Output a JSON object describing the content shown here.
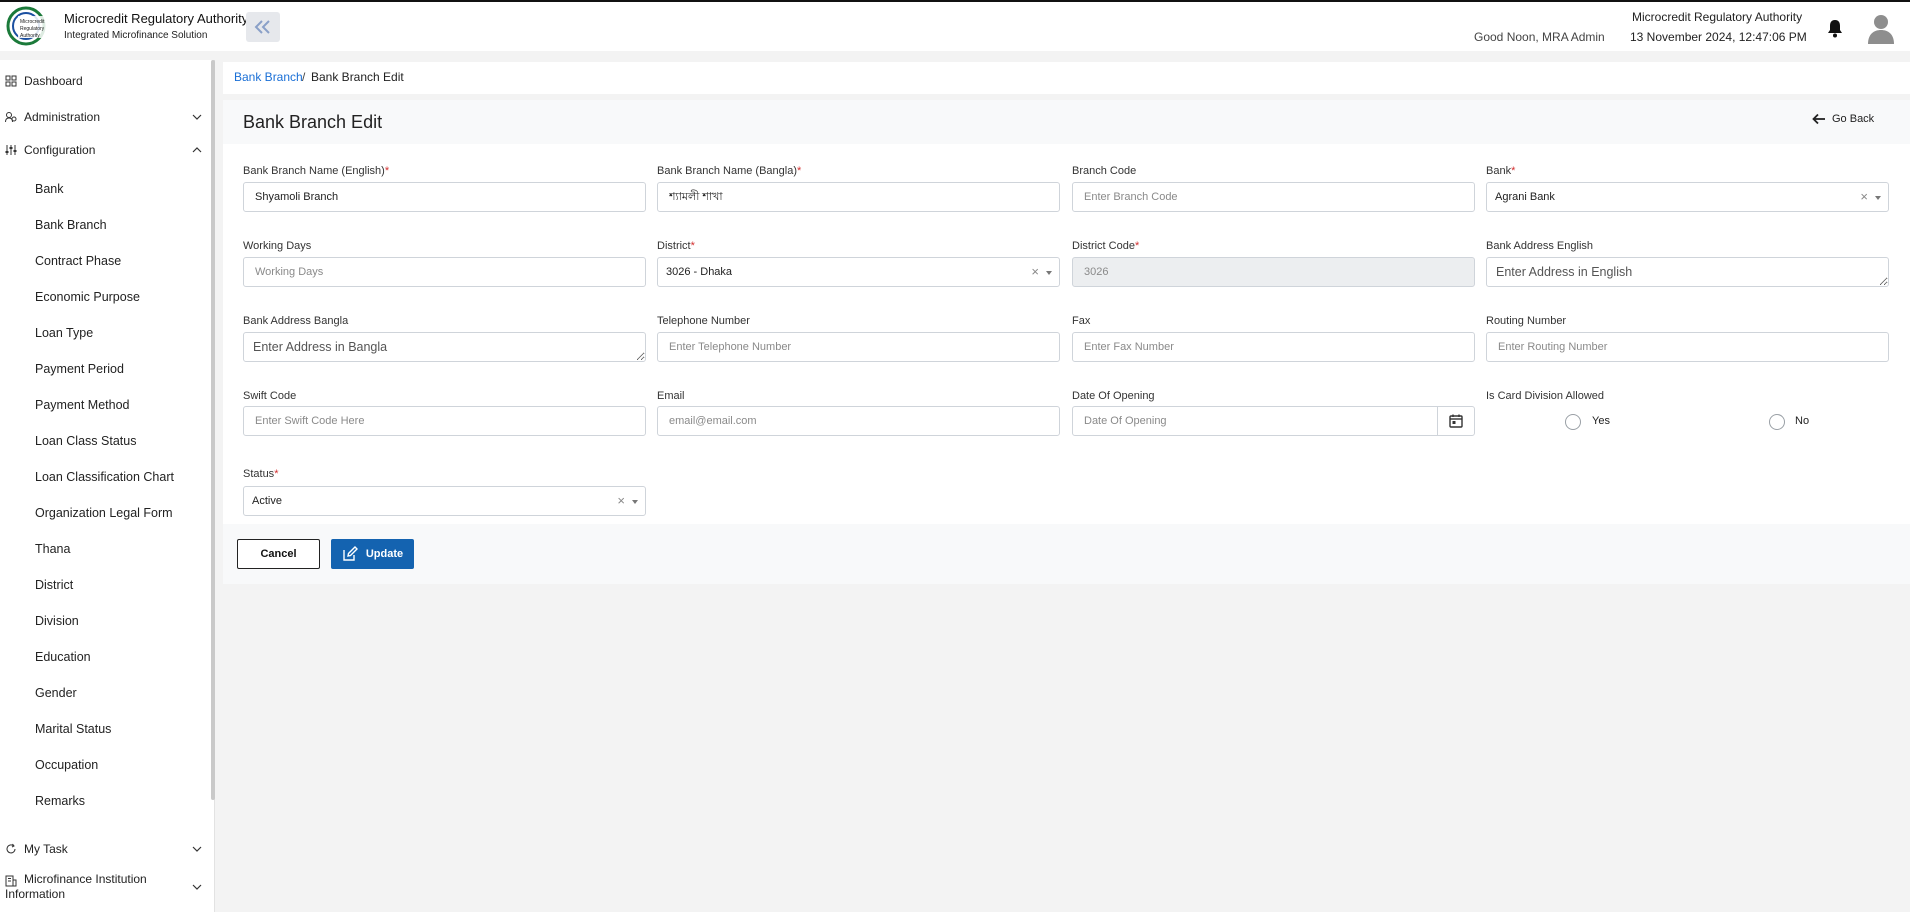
{
  "header": {
    "app_title": "Microcredit Regulatory Authority",
    "app_subtitle": "Integrated Microfinance Solution",
    "greeting": "Good Noon, MRA Admin",
    "org_name": "Microcredit Regulatory Authority",
    "datetime": "13 November 2024, 12:47:06 PM"
  },
  "sidebar": {
    "dashboard": "Dashboard",
    "administration": "Administration",
    "configuration": "Configuration",
    "config_items": [
      "Bank",
      "Bank Branch",
      "Contract Phase",
      "Economic Purpose",
      "Loan Type",
      "Payment Period",
      "Payment Method",
      "Loan Class Status",
      "Loan Classification Chart",
      "Organization Legal Form",
      "Thana",
      "District",
      "Division",
      "Education",
      "Gender",
      "Marital Status",
      "Occupation",
      "Remarks"
    ],
    "my_task": "My Task",
    "mfi_info_line1": "Microfinance Institution",
    "mfi_info_line2": "Information"
  },
  "breadcrumb": {
    "parent": "Bank Branch",
    "separator": "/",
    "current": "Bank Branch Edit"
  },
  "page": {
    "title": "Bank Branch Edit",
    "go_back": "Go Back"
  },
  "form": {
    "name_en": {
      "label": "Bank Branch Name (English)",
      "value": "Shyamoli Branch"
    },
    "name_bn": {
      "label": "Bank Branch Name (Bangla)",
      "value": "শ্যামলী শাখা"
    },
    "branch_code": {
      "label": "Branch Code",
      "placeholder": "Enter Branch Code"
    },
    "bank": {
      "label": "Bank",
      "value": "Agrani Bank"
    },
    "working_days": {
      "label": "Working Days",
      "placeholder": "Working Days"
    },
    "district": {
      "label": "District",
      "value": "3026 - Dhaka"
    },
    "district_code": {
      "label": "District Code",
      "value": "3026"
    },
    "address_en": {
      "label": "Bank Address English",
      "placeholder": "Enter Address in English"
    },
    "address_bn": {
      "label": "Bank Address Bangla",
      "placeholder": "Enter Address in Bangla"
    },
    "telephone": {
      "label": "Telephone Number",
      "placeholder": "Enter Telephone Number"
    },
    "fax": {
      "label": "Fax",
      "placeholder": "Enter Fax Number"
    },
    "routing": {
      "label": "Routing Number",
      "placeholder": "Enter Routing Number"
    },
    "swift": {
      "label": "Swift Code",
      "placeholder": "Enter Swift Code Here"
    },
    "email": {
      "label": "Email",
      "placeholder": "email@email.com"
    },
    "opening_date": {
      "label": "Date Of Opening",
      "placeholder": "Date Of Opening"
    },
    "card_division": {
      "label": "Is Card Division Allowed",
      "yes": "Yes",
      "no": "No"
    },
    "status": {
      "label": "Status",
      "value": "Active"
    },
    "required_mark": "*",
    "clear_symbol": "×"
  },
  "actions": {
    "cancel": "Cancel",
    "update": "Update"
  },
  "colors": {
    "primary": "#1463b0",
    "link": "#1a6fd6",
    "required": "#d32f2f"
  }
}
